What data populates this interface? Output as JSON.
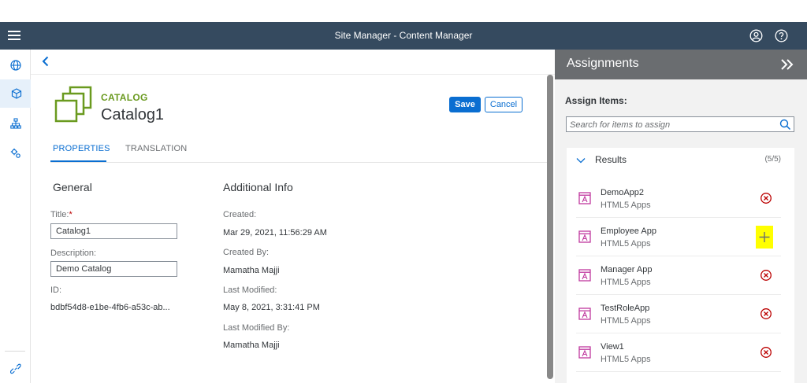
{
  "shell": {
    "title": "Site Manager - Content Manager"
  },
  "catalog": {
    "type": "CATALOG",
    "name": "Catalog1"
  },
  "actions": {
    "save": "Save",
    "cancel": "Cancel"
  },
  "tabs": [
    {
      "label": "PROPERTIES"
    },
    {
      "label": "TRANSLATION"
    }
  ],
  "general": {
    "title": "General",
    "title_label": "Title:",
    "required_mark": "*",
    "title_value": "Catalog1",
    "description_label": "Description:",
    "description_value": "Demo Catalog",
    "id_label": "ID:",
    "id_value": "bdbf54d8-e1be-4fb6-a53c-ab..."
  },
  "additional": {
    "title": "Additional Info",
    "created_label": "Created:",
    "created_value": "Mar 29, 2021, 11:56:29 AM",
    "created_by_label": "Created By:",
    "created_by_value": "Mamatha Majji",
    "modified_label": "Last Modified:",
    "modified_value": "May 8, 2021, 3:31:41 PM",
    "modified_by_label": "Last Modified By:",
    "modified_by_value": "Mamatha Majji"
  },
  "assignments": {
    "title": "Assignments",
    "assign_label": "Assign Items:",
    "search_placeholder": "Search for items to assign",
    "results_title": "Results",
    "results_count": "(5/5)",
    "items": [
      {
        "name": "DemoApp2",
        "type": "HTML5 Apps",
        "action": "remove"
      },
      {
        "name": "Employee App",
        "type": "HTML5 Apps",
        "action": "add"
      },
      {
        "name": "Manager App",
        "type": "HTML5 Apps",
        "action": "remove"
      },
      {
        "name": "TestRoleApp",
        "type": "HTML5 Apps",
        "action": "remove"
      },
      {
        "name": "View1",
        "type": "HTML5 Apps",
        "action": "remove"
      }
    ]
  },
  "colors": {
    "shell": "#354a5f",
    "accent": "#0a6ed1",
    "catalog_green": "#6a9a1f",
    "app_icon": "#c0399f",
    "remove": "#bb0000",
    "panel_header": "#6a6d70"
  }
}
